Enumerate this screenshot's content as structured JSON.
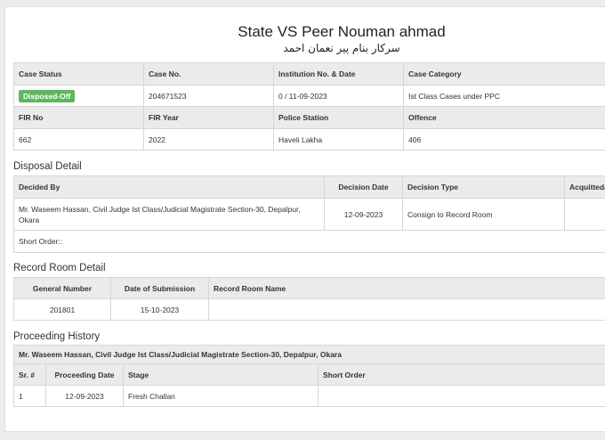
{
  "header": {
    "title": "State VS Peer Nouman ahmad",
    "subtitle": "سرکار بنام پیر نعمان احمد"
  },
  "case_info": {
    "headers": [
      "Case Status",
      "Case No.",
      "Institution No. & Date",
      "Case Category"
    ],
    "status_badge": "Disposed-Off",
    "case_no": "204671523",
    "institution": "0 / 11-09-2023",
    "category": "Ist Class Cases under PPC",
    "headers2": [
      "FIR No",
      "FIR Year",
      "Police Station",
      "Offence"
    ],
    "fir_no": "662",
    "fir_year": "2022",
    "police_station": "Haveli Lakha",
    "offence": "406"
  },
  "disposal": {
    "section_title": "Disposal Detail",
    "headers": [
      "Decided By",
      "Decision Date",
      "Decision Type",
      "Acquitted/"
    ],
    "decided_by": "Mr. Waseem Hassan, Civil Judge Ist Class/Judicial Magistrate Section-30, Depalpur, Okara",
    "decision_date": "12-09-2023",
    "decision_type": "Consign to Record Room",
    "acquitted": "",
    "short_order": "Short Order::"
  },
  "record_room": {
    "section_title": "Record Room Detail",
    "headers": [
      "General Number",
      "Date of Submission",
      "Record Room Name"
    ],
    "general_number": "201801",
    "date_of_submission": "15-10-2023",
    "record_room_name": ""
  },
  "proceedings": {
    "section_title": "Proceeding History",
    "court": "Mr. Waseem Hassan, Civil Judge Ist Class/Judicial Magistrate Section-30, Depalpur, Okara",
    "headers": [
      "Sr. #",
      "Proceeding Date",
      "Stage",
      "Short Order"
    ],
    "rows": [
      {
        "sr": "1",
        "date": "12-09-2023",
        "stage": "Fresh Challan",
        "short_order": ""
      }
    ]
  },
  "colors": {
    "badge": "#5cb85c",
    "header_bg": "#ebebeb",
    "border": "#d6d6d6"
  }
}
